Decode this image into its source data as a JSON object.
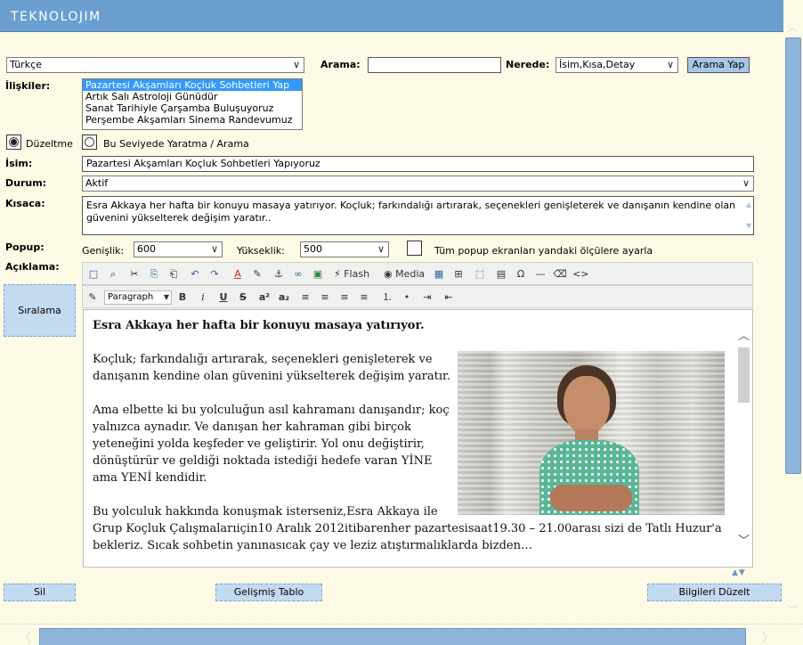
{
  "app": {
    "logo": "TEKNOLOJIM"
  },
  "search": {
    "language_value": "Türkçe",
    "arama_label": "Arama:",
    "arama_value": "",
    "nerede_label": "Nerede:",
    "nerede_value": "İsim,Kısa,Detay",
    "button": "Arama Yap"
  },
  "relations": {
    "label": "İlişkiler:",
    "items": [
      "Pazartesi Akşamları Koçluk Sohbetleri Yap",
      "Artık Salı Astroloji Günüdür",
      "Sanat Tarihiyle Çarşamba Buluşuyoruz",
      "Perşembe Akşamları Sinema Randevumuz"
    ],
    "selected_index": 0
  },
  "mode": {
    "edit_label": "Düzeltme",
    "edit_selected": true,
    "create_label": "Bu Seviyede Yaratma / Arama"
  },
  "form": {
    "name_label": "İsim:",
    "name_value": "Pazartesi Akşamları Koçluk Sohbetleri Yapıyoruz",
    "status_label": "Durum:",
    "status_value": "Aktif",
    "summary_label": "Kısaca:",
    "summary_value": "Esra Akkaya her hafta bir konuyu masaya yatırıyor. Koçluk; farkındalığı artırarak, seçenekleri genişleterek ve danışanın kendine olan güvenini yükselterek değişim yaratır..",
    "popup_label": "Popup:",
    "width_label": "Genişlik:",
    "width_value": "600",
    "height_label": "Yükseklik:",
    "height_value": "500",
    "apply_all_label": "Tüm popup ekranları yandaki ölçülere ayarla",
    "description_label": "Açıklama:"
  },
  "side": {
    "sort_button": "Sıralama"
  },
  "toolbar": {
    "row1": [
      "□",
      "⌕",
      "✂",
      "⎘",
      "⎗",
      "↶",
      "↷",
      "A",
      "✎",
      "⚓",
      "∞",
      "▣"
    ],
    "flash_label": "Flash",
    "media_label": "Media",
    "row1b": [
      "▦",
      "⊞",
      "⬚",
      "▤",
      "Ω",
      "—",
      "⌫",
      "<>"
    ],
    "paragraph_value": "Paragraph",
    "row2": [
      "B",
      "i",
      "U",
      "S",
      "a²",
      "a₂",
      "≡",
      "≡",
      "≡",
      "≡",
      "⒈",
      "•",
      "⇥",
      "⇤"
    ]
  },
  "editor": {
    "lead": "Esra Akkaya her hafta bir konuyu masaya yatırıyor.",
    "p1": "Koçluk; farkındalığı artırarak, seçenekleri genişleterek ve danışanın kendine olan güvenini yükselterek değişim yaratır.",
    "p2": "Ama elbette ki bu yolculuğun asıl kahramanı danışandır; koç yalnızca aynadır. Ve danışan her kahraman gibi birçok yeteneğini yolda keşfeder ve geliştirir. Yol onu değiştirir, dönüştürür ve geldiği noktada istediği hedefe varan YİNE ama YENİ kendidir.",
    "p3": "Bu yolculuk hakkında konuşmak isterseniz,Esra Akkaya ile Grup Koçluk Çalışmalarıiçin10 Aralık 2012itibarenher pazartesisaat19.30 – 21.00arası sizi de Tatlı Huzur'a bekleriz. Sıcak sohbetin yanınasıcak çay ve leziz atıştırmalıklarda bizden…"
  },
  "footer": {
    "delete_button": "Sil",
    "advanced_table_button": "Gelişmiş Tablo",
    "save_button": "Bilgileri Düzelt"
  },
  "colors": {
    "header": "#6a9fd0",
    "background": "#fdfbe6",
    "button": "#a8c6e8",
    "selected": "#3399ff"
  }
}
